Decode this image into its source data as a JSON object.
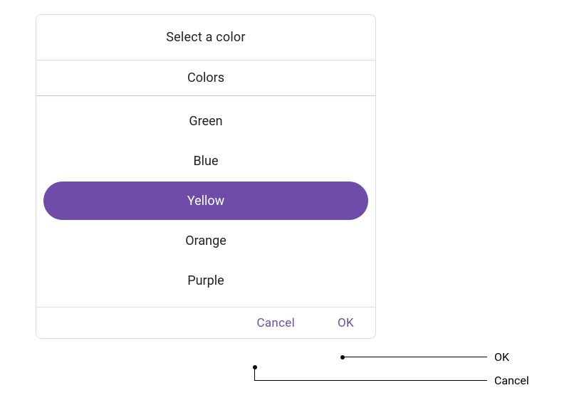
{
  "dialog": {
    "title": "Select a color",
    "subtitle": "Colors",
    "options": [
      "Green",
      "Blue",
      "Yellow",
      "Orange",
      "Purple"
    ],
    "selectedIndex": 2,
    "cancel_label": "Cancel",
    "ok_label": "OK"
  },
  "annotations": {
    "ok": "OK",
    "cancel": "Cancel"
  },
  "colors": {
    "accent": "#6f4caa"
  }
}
